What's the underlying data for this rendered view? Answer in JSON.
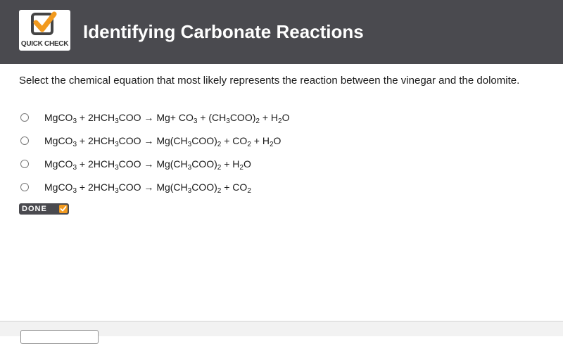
{
  "header": {
    "logo_text": "QUICK CHECK",
    "title": "Identifying Carbonate Reactions"
  },
  "question": {
    "text": "Select the chemical equation that most likely represents the reaction between the vinegar and the dolomite."
  },
  "options": [
    {
      "equation": "MgCO3 + 2HCH3COO → Mg+ CO3 + (CH3COO)2 + H2O"
    },
    {
      "equation": "MgCO3 + 2HCH3COO → Mg(CH3COO)2 + CO2 + H2O"
    },
    {
      "equation": "MgCO3 + 2HCH3COO → Mg(CH3COO)2 + H2O"
    },
    {
      "equation": "MgCO3 + 2HCH3COO → Mg(CH3COO)2 + CO2"
    }
  ],
  "done_button": {
    "label": "DONE"
  },
  "colors": {
    "header_bg": "#4a4a4f",
    "accent": "#f29a1e"
  }
}
